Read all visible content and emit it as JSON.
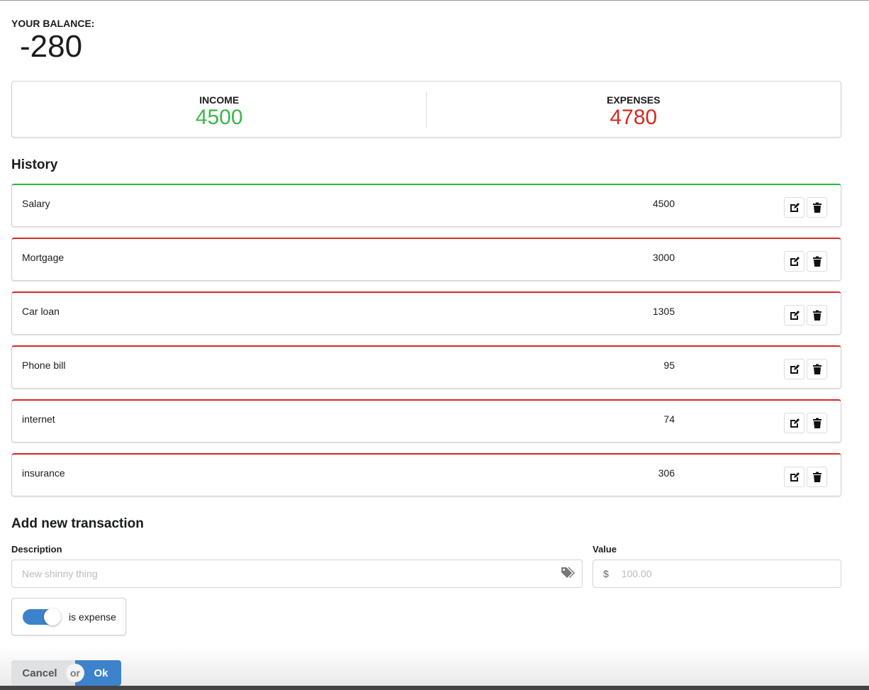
{
  "balance": {
    "label": "YOUR BALANCE:",
    "value": "-280"
  },
  "stats": {
    "income_label": "INCOME",
    "income": "4500",
    "expenses_label": "EXPENSES",
    "expenses": "4780"
  },
  "colors": {
    "income": "#21ba45",
    "expense": "#db2828",
    "accent": "#3d82cc"
  },
  "history": {
    "title": "History",
    "items": [
      {
        "description": "Salary",
        "amount": "4500",
        "type": "income"
      },
      {
        "description": "Mortgage",
        "amount": "3000",
        "type": "expense"
      },
      {
        "description": "Car loan",
        "amount": "1305",
        "type": "expense"
      },
      {
        "description": "Phone bill",
        "amount": "95",
        "type": "expense"
      },
      {
        "description": "internet",
        "amount": "74",
        "type": "expense"
      },
      {
        "description": "insurance",
        "amount": "306",
        "type": "expense"
      }
    ]
  },
  "form": {
    "title": "Add new transaction",
    "description_label": "Description",
    "description_placeholder": "New shinny thing",
    "value_label": "Value",
    "value_placeholder": "100.00",
    "currency": "$",
    "toggle_label": "is expense",
    "toggle_on": true,
    "cancel": "Cancel",
    "or": "or",
    "ok": "Ok"
  }
}
